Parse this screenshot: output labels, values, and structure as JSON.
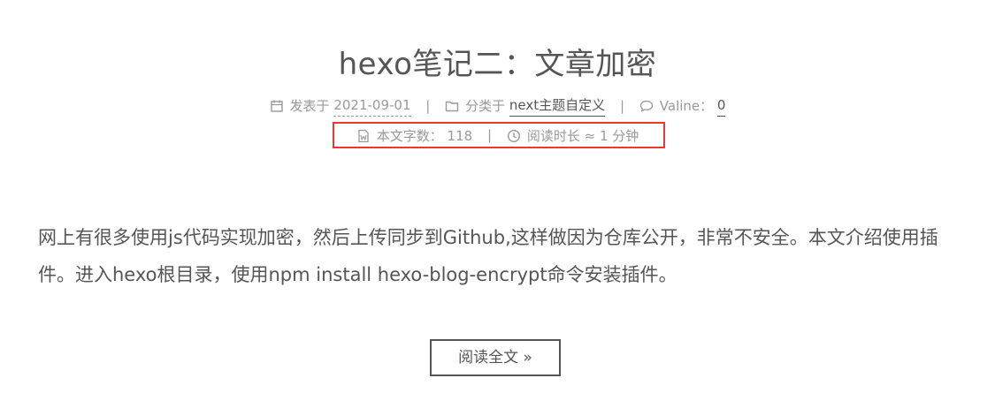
{
  "post": {
    "title": "hexo笔记二：文章加密",
    "meta": {
      "posted_label": "发表于",
      "posted_date": "2021-09-01",
      "category_label": "分类于",
      "category": "next主题自定义",
      "comments_label": "Valine：",
      "comments_count": "0",
      "wordcount_label": "本文字数：",
      "wordcount": "118",
      "readtime_label": "阅读时长 ≈",
      "readtime": "1 分钟"
    },
    "excerpt": "网上有很多使用js代码实现加密，然后上传同步到Github,这样做因为仓库公开，非常不安全。本文介绍使用插件。进入hexo根目录，使用npm install hexo-blog-encrypt命令安装插件。",
    "read_more_label": "阅读全文 »"
  },
  "separators": {
    "pipe": "|"
  },
  "colors": {
    "text": "#555555",
    "meta": "#999999",
    "highlight": "#e53935"
  },
  "icons": [
    "calendar-icon",
    "folder-icon",
    "comment-icon",
    "word-file-icon",
    "clock-icon"
  ]
}
